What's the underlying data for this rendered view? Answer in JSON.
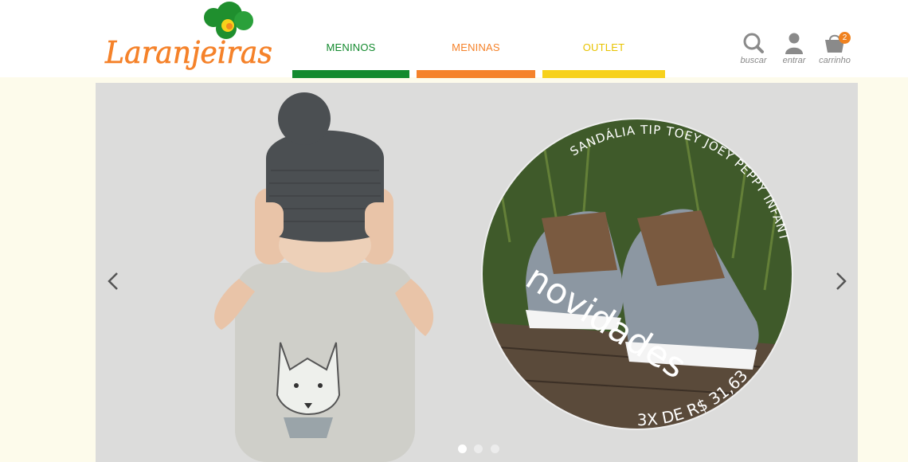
{
  "brand": {
    "logo_text": "Laranjeiras"
  },
  "colors": {
    "meninos": "#138a2e",
    "meninas": "#f5822a",
    "outlet": "#f7d11b",
    "banner_bg": "#dcdcdb",
    "page_bg": "#fdfbeb"
  },
  "nav": {
    "items": [
      {
        "label": "MENINOS",
        "color": "#138a2e"
      },
      {
        "label": "MENINAS",
        "color": "#f5822a"
      },
      {
        "label": "OUTLET",
        "color": "#e8c300"
      }
    ]
  },
  "tools": {
    "search": {
      "label": "buscar",
      "icon": "search-icon"
    },
    "login": {
      "label": "entrar",
      "icon": "user-icon"
    },
    "cart": {
      "label": "carrinho",
      "icon": "basket-icon",
      "count": "2"
    }
  },
  "banner": {
    "product_curve_text": "SANDÁLIA TIP TOEY JOEY PEPPY INFANTIL",
    "headline": "novidades",
    "price_text": "3X DE R$ 31,63",
    "slides": {
      "total": 3,
      "active": 1
    }
  }
}
